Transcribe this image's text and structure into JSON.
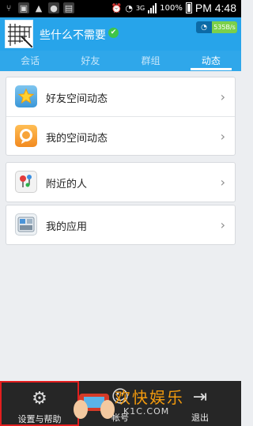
{
  "status_bar": {
    "network_type": "3G",
    "battery_percent": "100%",
    "time": "PM 4:48"
  },
  "header": {
    "nickname": "些什么不需要",
    "net_speed": "535B/s"
  },
  "tabs": [
    {
      "label": "会话",
      "active": false
    },
    {
      "label": "好友",
      "active": false
    },
    {
      "label": "群组",
      "active": false
    },
    {
      "label": "动态",
      "active": true
    }
  ],
  "groups": [
    {
      "items": [
        {
          "label": "好友空间动态",
          "icon": "star-icon"
        },
        {
          "label": "我的空间动态",
          "icon": "speech-bubble-icon"
        }
      ]
    },
    {
      "items": [
        {
          "label": "附近的人",
          "icon": "nearby-pins-icon"
        }
      ]
    },
    {
      "items": [
        {
          "label": "我的应用",
          "icon": "apps-icon"
        }
      ]
    }
  ],
  "bottom_bar": {
    "settings_label": "设置与帮助",
    "account_label": "帐号",
    "exit_label": "退出"
  },
  "watermark": {
    "text": "欢快娱乐",
    "url": "K1C.COM"
  },
  "colors": {
    "header": "#27a4ea",
    "tab_bar": "#2fa7ea",
    "bottom_bar": "#262626",
    "highlight": "#e21e1e"
  }
}
